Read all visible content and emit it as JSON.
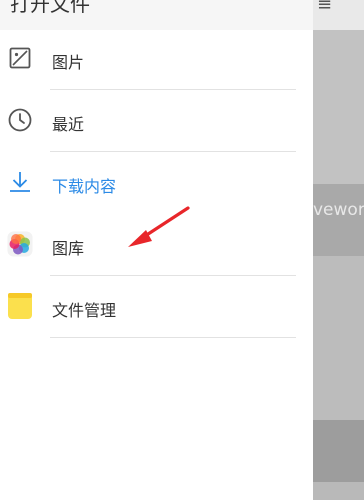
{
  "drawer": {
    "title": "打开文件",
    "items": [
      {
        "label": "图片",
        "icon": "image-icon",
        "active": false
      },
      {
        "label": "最近",
        "icon": "clock-icon",
        "active": false
      },
      {
        "label": "下载内容",
        "icon": "download-icon",
        "active": true
      },
      {
        "label": "图库",
        "icon": "photos-app-icon",
        "active": false
      },
      {
        "label": "文件管理",
        "icon": "file-manager-app-icon",
        "active": false
      }
    ]
  },
  "background_app": {
    "menu_glyph": "≡",
    "bar_text": "veworl"
  },
  "colors": {
    "accent": "#2b8ae6",
    "annotation_arrow": "#e8262a",
    "scrim": "#b4b4b4"
  }
}
